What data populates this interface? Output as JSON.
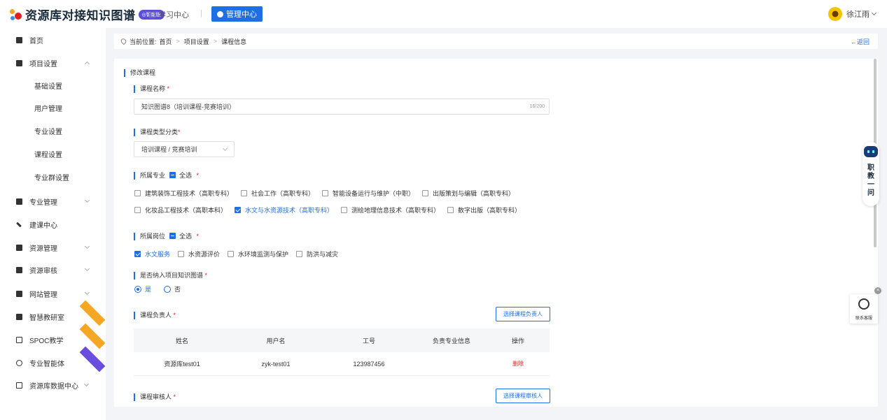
{
  "header": {
    "app_title": "资源库对接知识图谱",
    "ai_badge": "◎智能版",
    "nav_learning": "学习中心",
    "separator": "|",
    "nav_admin": "管理中心",
    "user_name": "徐江雨"
  },
  "sidebar": {
    "items": [
      {
        "label": "首页"
      },
      {
        "label": "项目设置"
      },
      {
        "label": "专业管理"
      },
      {
        "label": "建课中心"
      },
      {
        "label": "资源管理"
      },
      {
        "label": "资源审核"
      },
      {
        "label": "网站管理"
      },
      {
        "label": "智慧教研室"
      },
      {
        "label": "SPOC教学"
      },
      {
        "label": "专业智能体"
      },
      {
        "label": "资源库数据中心"
      }
    ],
    "sub_items": [
      {
        "label": "基础设置"
      },
      {
        "label": "用户管理"
      },
      {
        "label": "专业设置"
      },
      {
        "label": "课程设置"
      },
      {
        "label": "专业群设置"
      }
    ],
    "ribbon_colors": {
      "orange": "#f5a623",
      "purple": "#6a4de0"
    }
  },
  "breadcrumb": {
    "prefix": "当前位置:",
    "items": [
      "首页",
      "项目设置",
      "课程信息"
    ],
    "separator": ">",
    "back_label": "←返回"
  },
  "form": {
    "page_title": "修改课程",
    "name_label": "课程名称",
    "name_value": "知识图谱8（培训课程-竞赛培训）",
    "name_count": "16/200",
    "type_label": "课程类型分类",
    "type_value": "培训课程 / 竞赛培训",
    "major_label": "所属专业",
    "select_all": "全选",
    "majors_row1": [
      {
        "label": "建筑装饰工程技术（高职专科）",
        "checked": false
      },
      {
        "label": "社会工作（高职专科）",
        "checked": false
      },
      {
        "label": "智能设备运行与维护（中职）",
        "checked": false
      },
      {
        "label": "出版策划与编辑（高职专科）",
        "checked": false
      }
    ],
    "majors_row2": [
      {
        "label": "化妆品工程技术（高职本科）",
        "checked": false
      },
      {
        "label": "水文与水资源技术（高职专科）",
        "checked": true
      },
      {
        "label": "测绘地理信息技术（高职专科）",
        "checked": false
      },
      {
        "label": "数字出版（高职专科）",
        "checked": false
      }
    ],
    "post_label": "所属岗位",
    "posts": [
      {
        "label": "水文服务",
        "checked": true
      },
      {
        "label": "水资源评价",
        "checked": false
      },
      {
        "label": "水环境监测与保护",
        "checked": false
      },
      {
        "label": "防洪与减灾",
        "checked": false
      }
    ],
    "kg_label": "是否纳入项目知识图谱",
    "kg_yes": "是",
    "kg_no": "否",
    "owner_label": "课程负责人",
    "owner_button": "选择课程负责人",
    "table_headers": [
      "姓名",
      "用户名",
      "工号",
      "负责专业信息",
      "操作"
    ],
    "table_rows": [
      {
        "name": "资源库test01",
        "username": "zyk-test01",
        "id": "123987456",
        "major": "",
        "action": "删除"
      }
    ],
    "reviewer_label": "课程审核人",
    "reviewer_button": "选择课程审核人",
    "required_mark": "*"
  },
  "floating": {
    "helper_text": "职教一问",
    "service_label": "联系客服",
    "close": "×"
  },
  "colors": {
    "accent": "#1e6ee6",
    "danger": "#e02020"
  }
}
